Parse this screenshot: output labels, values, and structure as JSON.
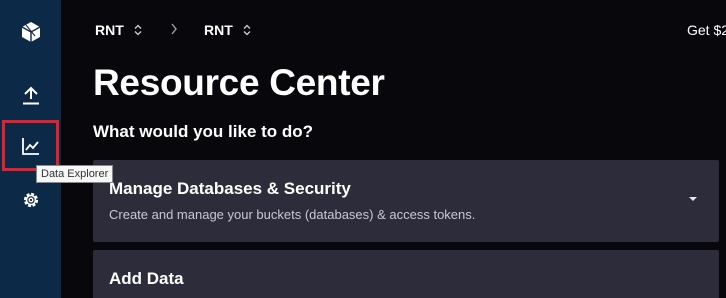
{
  "sidebar": {
    "items": [
      {
        "icon": "cube-logo-icon"
      },
      {
        "icon": "upload-icon"
      },
      {
        "icon": "chart-line-icon"
      },
      {
        "icon": "gear-icon"
      }
    ],
    "tooltip": "Data Explorer",
    "highlight_color": "#e4222b"
  },
  "breadcrumb": {
    "org": "RNT",
    "bucket": "RNT"
  },
  "header": {
    "get_link": "Get $2"
  },
  "main": {
    "title": "Resource Center",
    "subtitle": "What would you like to do?",
    "cards": [
      {
        "title": "Manage Databases & Security",
        "description": "Create and manage your buckets (databases) & access tokens."
      },
      {
        "title": "Add Data",
        "description": ""
      }
    ]
  },
  "colors": {
    "sidebar_bg": "#0c2a47",
    "page_bg": "#07070c",
    "card_bg": "#2d2c3a"
  }
}
